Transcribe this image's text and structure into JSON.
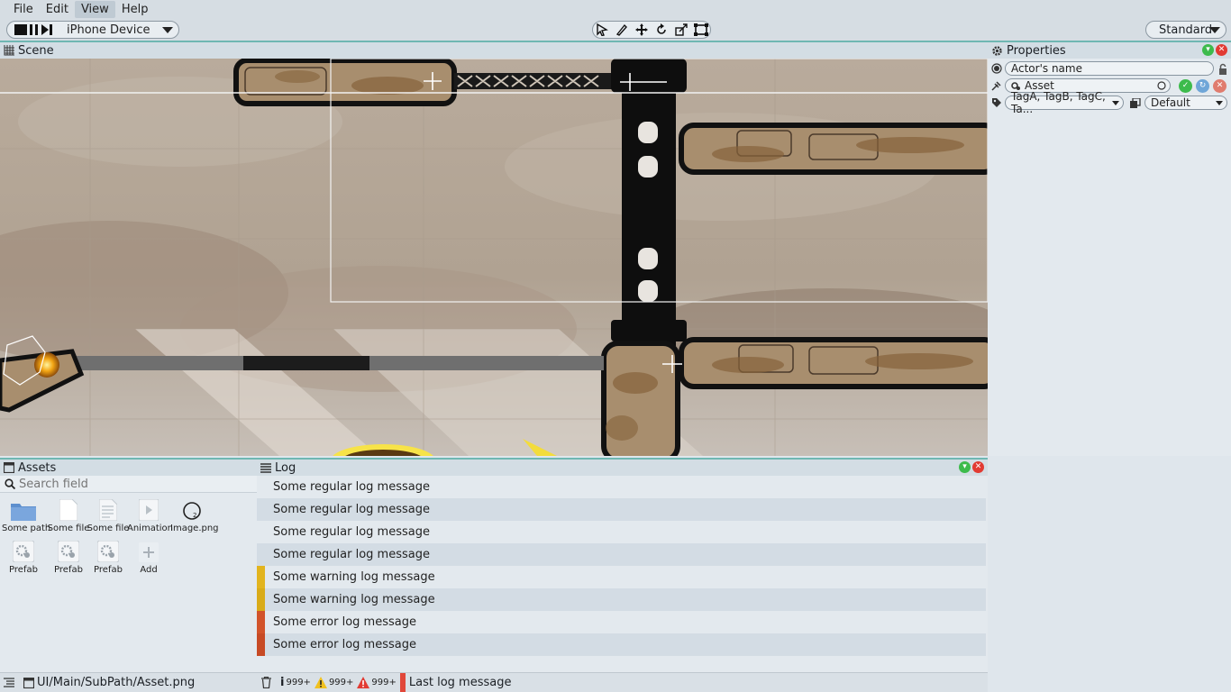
{
  "menu": [
    "File",
    "Edit",
    "View",
    "Help"
  ],
  "toolbar": {
    "device": "iPhone Device",
    "layout": "Standard"
  },
  "scene": {
    "title": "Scene"
  },
  "properties": {
    "title": "Properties",
    "name_placeholder": "Actor's name",
    "asset": "Asset",
    "tags": "TagA, TagB, TagC, Ta...",
    "layer": "Default"
  },
  "assets": {
    "title": "Assets",
    "search_placeholder": "Search field",
    "items": [
      {
        "label": "Some path",
        "icon": "folder-icon"
      },
      {
        "label": "Some file",
        "icon": "file-icon"
      },
      {
        "label": "Some file",
        "icon": "text-file-icon"
      },
      {
        "label": "Animation",
        "icon": "animation-icon"
      },
      {
        "label": "Image.png",
        "icon": "image-icon"
      },
      {
        "label": "Prefab",
        "icon": "prefab-icon"
      },
      {
        "label": "Prefab",
        "icon": "prefab-icon"
      },
      {
        "label": "Prefab",
        "icon": "prefab-icon"
      },
      {
        "label": "Add",
        "icon": "add-icon"
      }
    ]
  },
  "log": {
    "title": "Log",
    "messages": [
      {
        "text": "Some regular log message",
        "level": "regular"
      },
      {
        "text": "Some regular log message",
        "level": "regular"
      },
      {
        "text": "Some regular log message",
        "level": "regular"
      },
      {
        "text": "Some regular log message",
        "level": "regular"
      },
      {
        "text": "Some warning log message",
        "level": "warning"
      },
      {
        "text": "Some warning log message",
        "level": "warning"
      },
      {
        "text": "Some error log message",
        "level": "error"
      },
      {
        "text": "Some error log message",
        "level": "error"
      }
    ]
  },
  "status": {
    "path": "UI/Main/SubPath/Asset.png",
    "info_count": "999+",
    "warning_count": "999+",
    "error_count": "999+",
    "last_message": "Last log message"
  },
  "colors": {
    "accent": "#6fb7b2",
    "warning": "#e2b41e",
    "error": "#d2532a",
    "close": "#e23b33",
    "ok": "#3dbb4c"
  }
}
